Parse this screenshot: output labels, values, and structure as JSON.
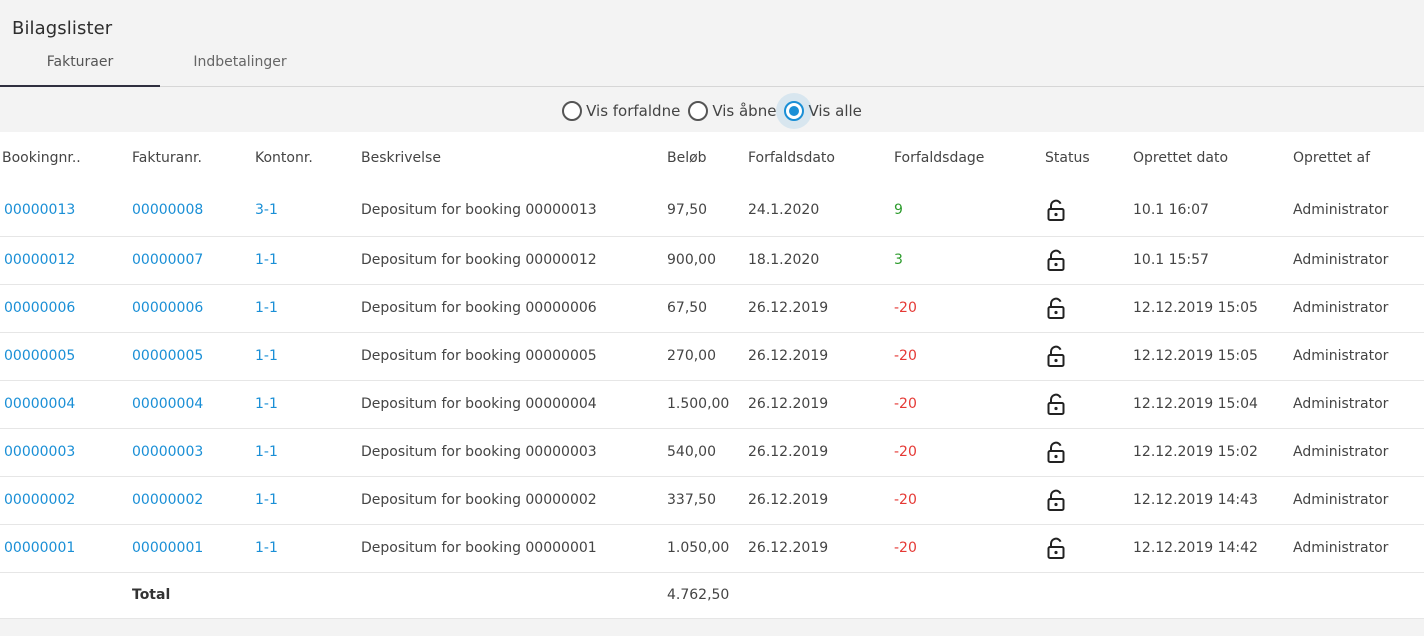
{
  "page_title": "Bilagslister",
  "tabs": [
    {
      "label": "Fakturaer",
      "active": true
    },
    {
      "label": "Indbetalinger",
      "active": false
    }
  ],
  "filters": [
    {
      "label": "Vis forfaldne",
      "checked": false
    },
    {
      "label": "Vis åbne",
      "checked": false
    },
    {
      "label": "Vis alle",
      "checked": true
    }
  ],
  "table": {
    "headers": [
      "Bookingnr..",
      "Fakturanr.",
      "Kontonr.",
      "Beskrivelse",
      "Beløb",
      "Forfaldsdato",
      "Forfaldsdage",
      "Status",
      "Oprettet dato",
      "Oprettet af"
    ],
    "rows": [
      {
        "booking": "00000013",
        "invoice": "00000008",
        "account": "3-1",
        "description": "Depositum for booking 00000013",
        "amount": "97,50",
        "due_date": "24.1.2020",
        "due_days": "9",
        "status_icon": "unlock-icon",
        "created": "10.1 16:07",
        "created_by": "Administrator"
      },
      {
        "booking": "00000012",
        "invoice": "00000007",
        "account": "1-1",
        "description": "Depositum for booking 00000012",
        "amount": "900,00",
        "due_date": "18.1.2020",
        "due_days": "3",
        "status_icon": "unlock-icon",
        "created": "10.1 15:57",
        "created_by": "Administrator"
      },
      {
        "booking": "00000006",
        "invoice": "00000006",
        "account": "1-1",
        "description": "Depositum for booking 00000006",
        "amount": "67,50",
        "due_date": "26.12.2019",
        "due_days": "-20",
        "status_icon": "unlock-icon",
        "created": "12.12.2019 15:05",
        "created_by": "Administrator"
      },
      {
        "booking": "00000005",
        "invoice": "00000005",
        "account": "1-1",
        "description": "Depositum for booking 00000005",
        "amount": "270,00",
        "due_date": "26.12.2019",
        "due_days": "-20",
        "status_icon": "unlock-icon",
        "created": "12.12.2019 15:05",
        "created_by": "Administrator"
      },
      {
        "booking": "00000004",
        "invoice": "00000004",
        "account": "1-1",
        "description": "Depositum for booking 00000004",
        "amount": "1.500,00",
        "due_date": "26.12.2019",
        "due_days": "-20",
        "status_icon": "unlock-icon",
        "created": "12.12.2019 15:04",
        "created_by": "Administrator"
      },
      {
        "booking": "00000003",
        "invoice": "00000003",
        "account": "1-1",
        "description": "Depositum for booking 00000003",
        "amount": "540,00",
        "due_date": "26.12.2019",
        "due_days": "-20",
        "status_icon": "unlock-icon",
        "created": "12.12.2019 15:02",
        "created_by": "Administrator"
      },
      {
        "booking": "00000002",
        "invoice": "00000002",
        "account": "1-1",
        "description": "Depositum for booking 00000002",
        "amount": "337,50",
        "due_date": "26.12.2019",
        "due_days": "-20",
        "status_icon": "unlock-icon",
        "created": "12.12.2019 14:43",
        "created_by": "Administrator"
      },
      {
        "booking": "00000001",
        "invoice": "00000001",
        "account": "1-1",
        "description": "Depositum for booking 00000001",
        "amount": "1.050,00",
        "due_date": "26.12.2019",
        "due_days": "-20",
        "status_icon": "unlock-icon",
        "created": "12.12.2019 14:42",
        "created_by": "Administrator"
      }
    ],
    "total_label": "Total",
    "total_amount": "4.762,50"
  },
  "colors": {
    "link": "#1a8fd6",
    "positive": "#2e9c2e",
    "negative": "#e53935",
    "radio_active": "#1a8fd6"
  }
}
